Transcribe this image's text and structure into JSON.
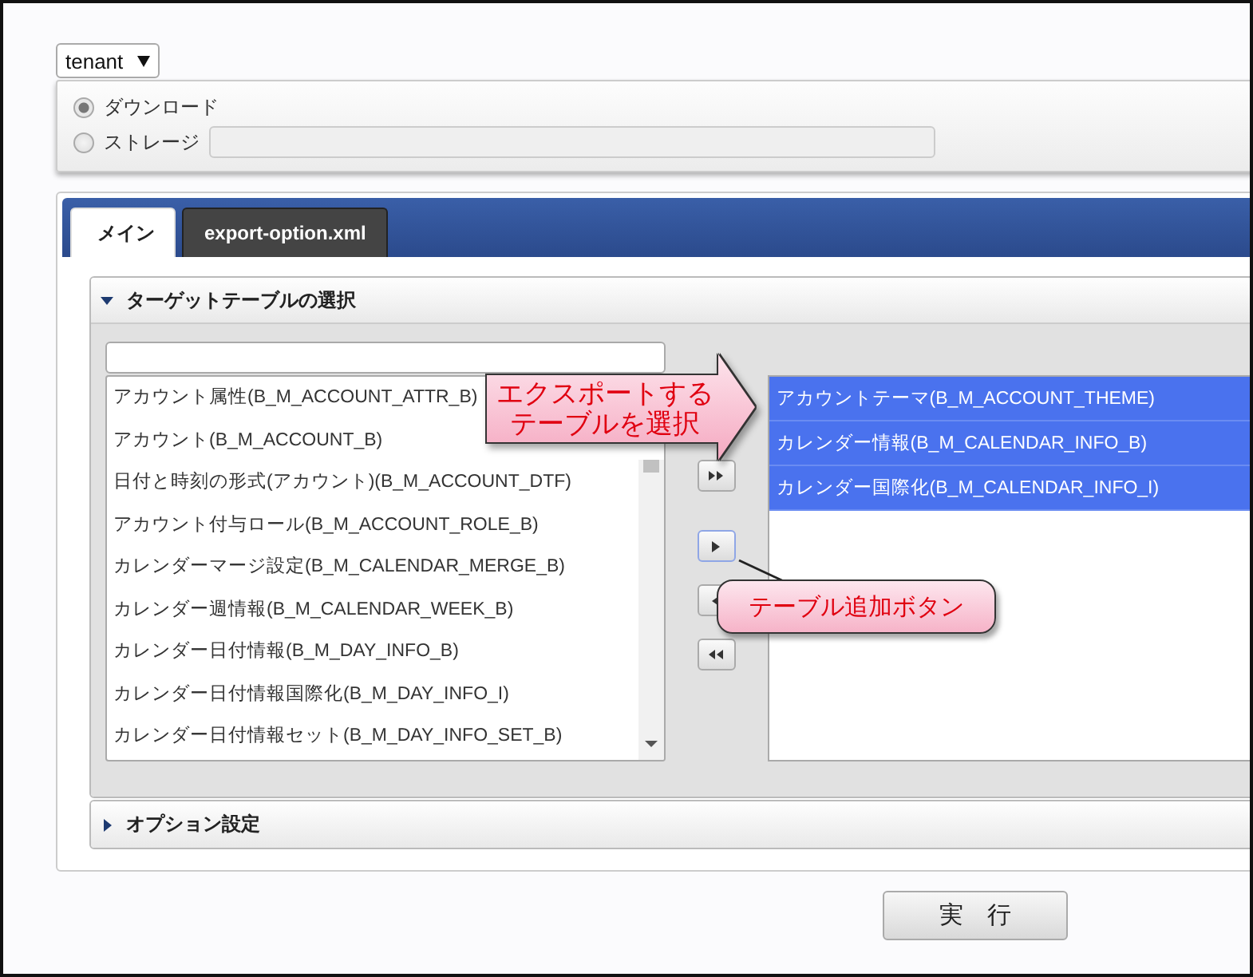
{
  "tenant_select": {
    "value": "tenant"
  },
  "output_options": [
    {
      "label": "ダウンロード",
      "selected": true,
      "kind": "plain"
    },
    {
      "label": "ストレージ",
      "selected": false,
      "kind": "field"
    }
  ],
  "tabs": [
    {
      "label": "メイン",
      "selected": true
    },
    {
      "label": "export-option.xml",
      "selected": false
    }
  ],
  "sections": [
    {
      "title": "ターゲットテーブルの選択",
      "expanded": true
    },
    {
      "title": "オプション設定",
      "expanded": false
    }
  ],
  "available_tables": [
    {
      "label": "アカウント属性(B_M_ACCOUNT_ATTR_B)",
      "selected": false
    },
    {
      "label": "アカウント(B_M_ACCOUNT_B)",
      "selected": false
    },
    {
      "label": "日付と時刻の形式(アカウント)(B_M_ACCOUNT_DTF)",
      "selected": false
    },
    {
      "label": "アカウント付与ロール(B_M_ACCOUNT_ROLE_B)",
      "selected": false
    },
    {
      "label": "カレンダーマージ設定(B_M_CALENDAR_MERGE_B)",
      "selected": false
    },
    {
      "label": "カレンダー週情報(B_M_CALENDAR_WEEK_B)",
      "selected": false
    },
    {
      "label": "カレンダー日付情報(B_M_DAY_INFO_B)",
      "selected": false
    },
    {
      "label": "カレンダー日付情報国際化(B_M_DAY_INFO_I)",
      "selected": false
    },
    {
      "label": "カレンダー日付情報セット(B_M_DAY_INFO_SET_B)",
      "selected": false
    }
  ],
  "move_buttons": [
    {
      "kind": "add_all"
    },
    {
      "kind": "add"
    },
    {
      "kind": "remove"
    },
    {
      "kind": "remove_all"
    }
  ],
  "chosen_tables": [
    {
      "label": "アカウントテーマ(B_M_ACCOUNT_THEME)",
      "selected": true
    },
    {
      "label": "カレンダー情報(B_M_CALENDAR_INFO_B)",
      "selected": true
    },
    {
      "label": "カレンダー国際化(B_M_CALENDAR_INFO_I)",
      "selected": true
    }
  ],
  "callouts": [
    {
      "kind": "arrow",
      "lines": [
        "エクスポートする",
        "テーブルを選択"
      ]
    },
    {
      "kind": "rounded",
      "lines": [
        "テーブル追加ボタン"
      ]
    }
  ],
  "run_button": {
    "label": "実　行"
  }
}
